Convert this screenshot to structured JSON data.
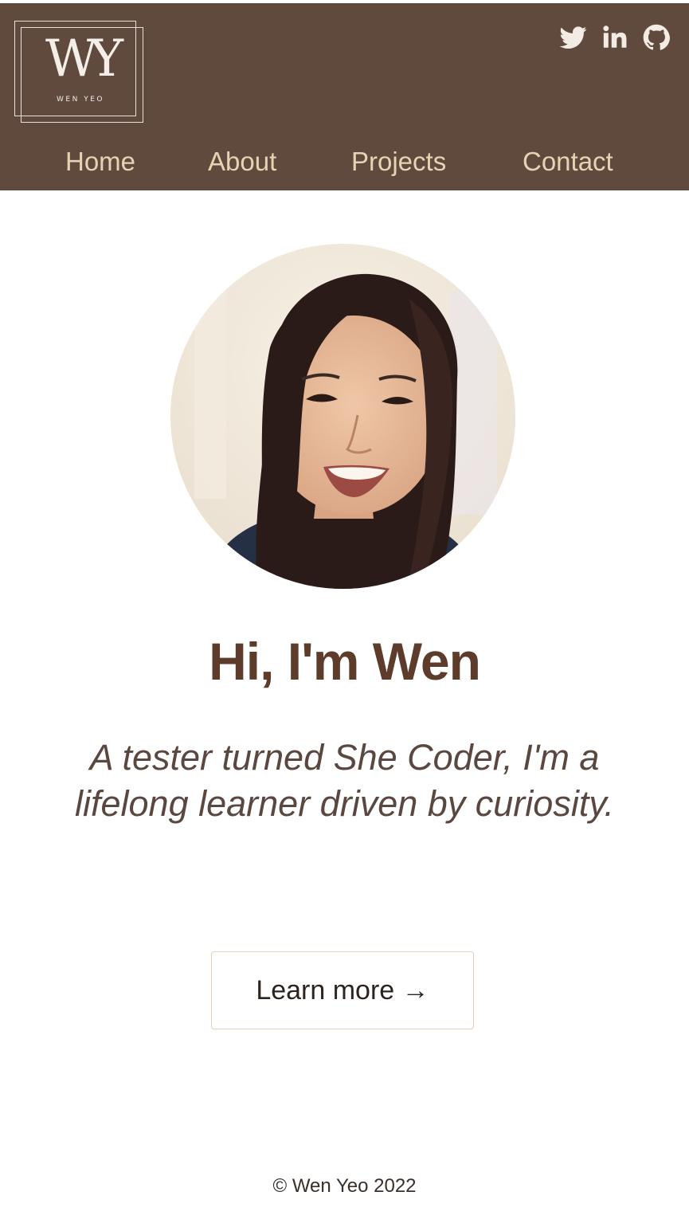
{
  "header": {
    "logo": {
      "monogram": "WY",
      "name": "WEN YEO"
    },
    "social": [
      {
        "name": "twitter",
        "icon": "twitter-icon"
      },
      {
        "name": "linkedin",
        "icon": "linkedin-icon"
      },
      {
        "name": "github",
        "icon": "github-icon"
      }
    ],
    "nav": [
      {
        "label": "Home"
      },
      {
        "label": "About"
      },
      {
        "label": "Projects"
      },
      {
        "label": "Contact"
      }
    ]
  },
  "hero": {
    "title": "Hi, I'm Wen",
    "tagline": "A tester turned She Coder, I'm a lifelong learner driven by curiosity.",
    "cta_label": "Learn more →"
  },
  "footer": {
    "copyright": "© Wen Yeo 2022"
  },
  "colors": {
    "header_bg": "#5f4a3d",
    "nav_text": "#e8d2b3",
    "title": "#5d3c2c",
    "button_border": "#e4d2b9"
  }
}
